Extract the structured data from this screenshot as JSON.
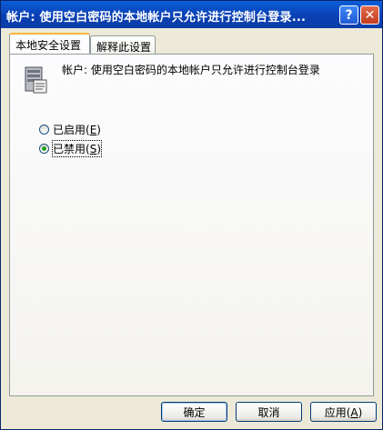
{
  "window": {
    "title": "帐户: 使用空白密码的本地帐户只允许进行控制台登录...",
    "help_glyph": "?",
    "close_glyph": "✕"
  },
  "tabs": [
    {
      "label": "本地安全设置",
      "active": true
    },
    {
      "label": "解释此设置",
      "active": false
    }
  ],
  "policy": {
    "icon": "policy-server-icon",
    "text": "帐户: 使用空白密码的本地帐户只允许进行控制台登录"
  },
  "options": [
    {
      "label": "已启用",
      "mnemonic": "E",
      "checked": false
    },
    {
      "label": "已禁用",
      "mnemonic": "S",
      "checked": true
    }
  ],
  "buttons": {
    "ok": "确定",
    "cancel": "取消",
    "apply_label": "应用",
    "apply_mnemonic": "A"
  }
}
